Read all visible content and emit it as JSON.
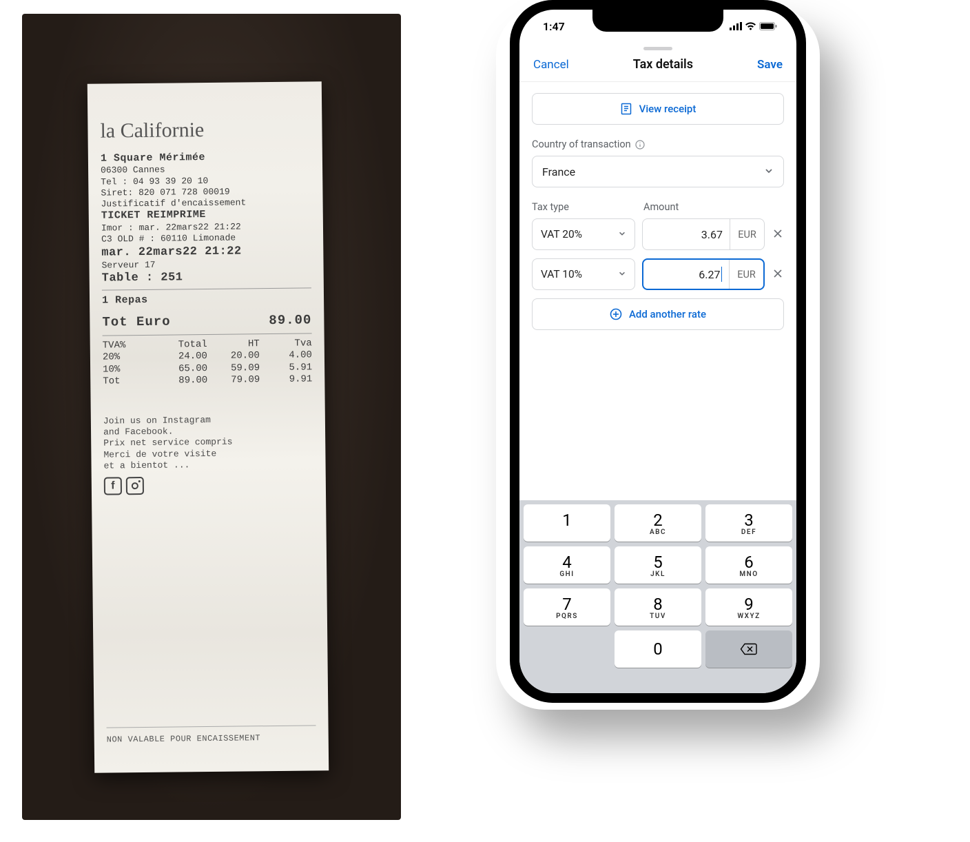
{
  "receipt": {
    "merchant_script": "la Californie",
    "address_line": "1 Square Mérimée",
    "postal_city": "06300 Cannes",
    "tel": "Tel : 04 93 39 20 10",
    "siret": "Siret: 820 071 728 00019",
    "justificatif": "Justificatif d'encaissement",
    "ticket_line": "TICKET REIMPRIME",
    "imor": "Imor : mar. 22mars22 21:22",
    "old_ref": "C3 OLD # : 60110 Limonade",
    "date_line": "mar. 22mars22 21:22",
    "serveur": "Serveur 17",
    "table": "Table : 251",
    "item": "1 Repas",
    "total_label": "Tot Euro",
    "total_value": "89.00",
    "tva_headers": [
      "TVA%",
      "Total",
      "HT",
      "Tva"
    ],
    "tva_rows": [
      [
        "20%",
        "24.00",
        "20.00",
        "4.00"
      ],
      [
        "10%",
        "65.00",
        "59.09",
        "5.91"
      ],
      [
        "Tot",
        "89.00",
        "79.09",
        "9.91"
      ]
    ],
    "footer1": "Join us on Instagram",
    "footer2": "and Facebook.",
    "footer3": "Prix net service compris",
    "footer4": "Merci de votre visite",
    "footer5": "et a bientot ...",
    "non_valable": "NON VALABLE POUR ENCAISSEMENT"
  },
  "phone": {
    "status_time": "1:47",
    "modal": {
      "cancel": "Cancel",
      "title": "Tax details",
      "save": "Save"
    },
    "view_receipt": "View receipt",
    "country_label": "Country of transaction",
    "country_value": "France",
    "col_tax_type": "Tax type",
    "col_amount": "Amount",
    "rows": [
      {
        "type": "VAT 20%",
        "amount": "3.67",
        "currency": "EUR",
        "focused": false
      },
      {
        "type": "VAT 10%",
        "amount": "6.27",
        "currency": "EUR",
        "focused": true
      }
    ],
    "add_another": "Add another rate",
    "keypad": {
      "r1": [
        {
          "n": "1",
          "s": ""
        },
        {
          "n": "2",
          "s": "ABC"
        },
        {
          "n": "3",
          "s": "DEF"
        }
      ],
      "r2": [
        {
          "n": "4",
          "s": "GHI"
        },
        {
          "n": "5",
          "s": "JKL"
        },
        {
          "n": "6",
          "s": "MNO"
        }
      ],
      "r3": [
        {
          "n": "7",
          "s": "PQRS"
        },
        {
          "n": "8",
          "s": "TUV"
        },
        {
          "n": "9",
          "s": "WXYZ"
        }
      ],
      "zero": "0"
    }
  }
}
